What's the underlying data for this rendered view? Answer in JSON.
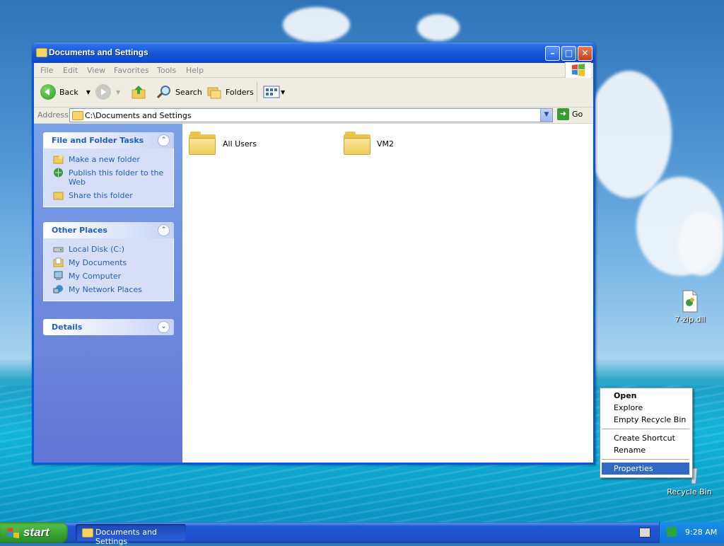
{
  "window": {
    "title": "Documents and Settings",
    "menu": [
      "File",
      "Edit",
      "View",
      "Favorites",
      "Tools",
      "Help"
    ],
    "toolbar": {
      "back": "Back",
      "search": "Search",
      "folders": "Folders"
    },
    "address": {
      "label": "Address",
      "value": "C:\\Documents and Settings",
      "go": "Go"
    },
    "task_pane": {
      "file_tasks": {
        "title": "File and Folder Tasks",
        "items": [
          "Make a new folder",
          "Publish this folder to the Web",
          "Share this folder"
        ]
      },
      "other_places": {
        "title": "Other Places",
        "items": [
          "Local Disk (C:)",
          "My Documents",
          "My Computer",
          "My Network Places"
        ]
      },
      "details": {
        "title": "Details"
      }
    },
    "folders": [
      "All Users",
      "VM2"
    ]
  },
  "desktop": {
    "icons": [
      "7-zip.dll",
      "Recycle Bin"
    ]
  },
  "context_menu": {
    "items": [
      "Open",
      "Explore",
      "Empty Recycle Bin",
      "Create Shortcut",
      "Rename",
      "Properties"
    ]
  },
  "taskbar": {
    "start": "start",
    "task": "Documents and Settings",
    "clock": "9:28 AM"
  }
}
